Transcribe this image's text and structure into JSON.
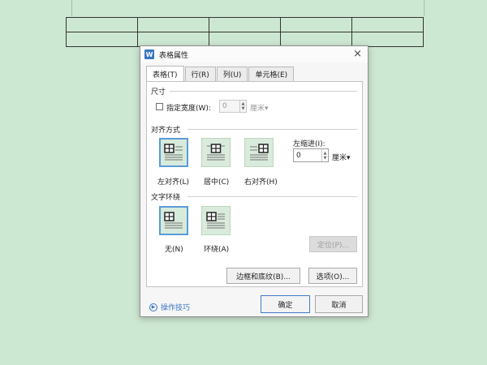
{
  "dialog": {
    "title": "表格属性",
    "app_icon": "W",
    "close_icon": "×",
    "tabs": [
      {
        "label": "表格(T)"
      },
      {
        "label": "行(R)"
      },
      {
        "label": "列(U)"
      },
      {
        "label": "单元格(E)"
      }
    ],
    "size": {
      "title": "尺寸",
      "specify_width_label": "指定宽度(W):",
      "width_value": "0",
      "unit": "厘米",
      "unit_arrow": "▾"
    },
    "alignment": {
      "title": "对齐方式",
      "options": [
        {
          "label": "左对齐(L)",
          "selected": true
        },
        {
          "label": "居中(C)",
          "selected": false
        },
        {
          "label": "右对齐(H)",
          "selected": false
        }
      ],
      "indent_label": "左缩进(I):",
      "indent_value": "0",
      "indent_unit": "厘米",
      "indent_unit_arrow": "▾"
    },
    "wrapping": {
      "title": "文字环绕",
      "options": [
        {
          "label": "无(N)",
          "selected": true
        },
        {
          "label": "环绕(A)",
          "selected": false
        }
      ],
      "position_button": "定位(P)..."
    },
    "borders_button": "边框和底纹(B)...",
    "options_button": "选项(O)...",
    "tips_label": "操作技巧",
    "ok_button": "确定",
    "cancel_button": "取消",
    "colors": {
      "background": "#cde8d2",
      "accent": "#3a76c4",
      "selection_border": "#5a9bd8"
    }
  }
}
